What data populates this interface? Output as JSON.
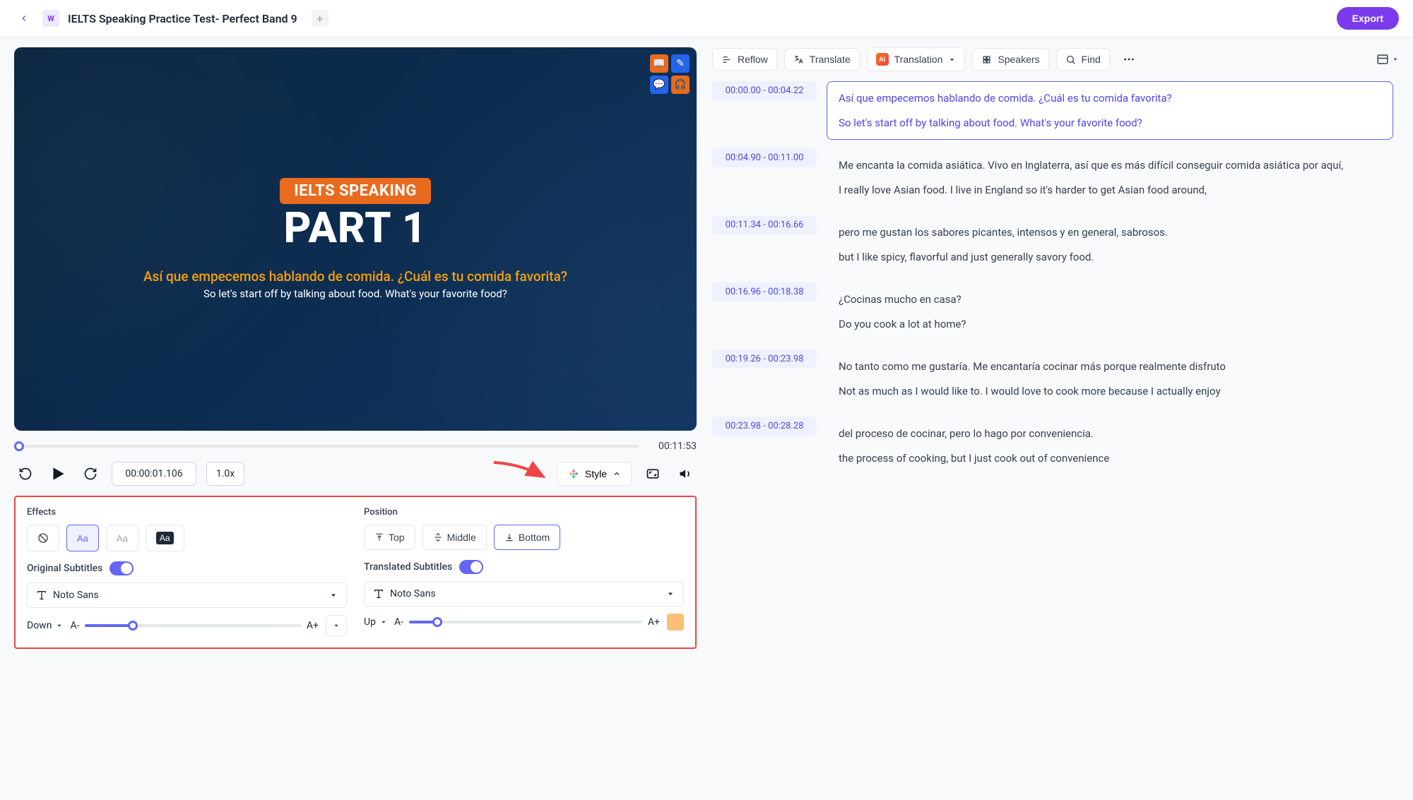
{
  "header": {
    "title": "IELTS Speaking Practice Test- Perfect Band 9",
    "export_label": "Export"
  },
  "video": {
    "pill": "IELTS SPEAKING",
    "main_title": "PART 1",
    "sub_orange": "Así que empecemos hablando de comida. ¿Cuál es tu comida favorita?",
    "sub_white": "So let's start off by talking about food. What's your favorite food?",
    "total_time": "00:11:53",
    "current_time": "00:00:01.106",
    "speed": "1.0x"
  },
  "style_button": "Style",
  "panel": {
    "effects_title": "Effects",
    "position_title": "Position",
    "pos_top": "Top",
    "pos_middle": "Middle",
    "pos_bottom": "Bottom",
    "original_label": "Original Subtitles",
    "translated_label": "Translated Subtitles",
    "font_original": "Noto Sans",
    "font_translated": "Noto Sans",
    "dir_down": "Down",
    "dir_up": "Up",
    "a_minus": "A-",
    "a_plus": "A+"
  },
  "toolbar": {
    "reflow": "Reflow",
    "translate": "Translate",
    "translation": "Translation",
    "speakers": "Speakers",
    "find": "Find"
  },
  "transcript": [
    {
      "ts": "00:00.00 - 00:04.22",
      "selected": true,
      "lines": [
        "Así que empecemos hablando de comida. ¿Cuál es tu comida favorita?",
        "So let's start off by talking about food. What's your favorite food?"
      ]
    },
    {
      "ts": "00:04.90 - 00:11.00",
      "selected": false,
      "lines": [
        "Me encanta la comida asiática. Vivo en Inglaterra, así que es más difícil conseguir comida asiática por aquí,",
        "I really love Asian food. I live in England so it's harder to get Asian food around,"
      ]
    },
    {
      "ts": "00:11.34 - 00:16.66",
      "selected": false,
      "lines": [
        "pero me gustan los sabores picantes, intensos y en general, sabrosos.",
        "but I like spicy, flavorful and just generally savory food."
      ]
    },
    {
      "ts": "00:16.96 - 00:18.38",
      "selected": false,
      "lines": [
        "¿Cocinas mucho en casa?",
        "Do you cook a lot at home?"
      ]
    },
    {
      "ts": "00:19.26 - 00:23.98",
      "selected": false,
      "lines": [
        "No tanto como me gustaría. Me encantaría cocinar más porque realmente disfruto",
        "Not as much as I would like to. I would love to cook more because I actually enjoy"
      ]
    },
    {
      "ts": "00:23.98 - 00:28.28",
      "selected": false,
      "lines": [
        "del proceso de cocinar, pero lo hago por conveniencia.",
        "the process of cooking, but I just cook out of convenience"
      ]
    }
  ]
}
